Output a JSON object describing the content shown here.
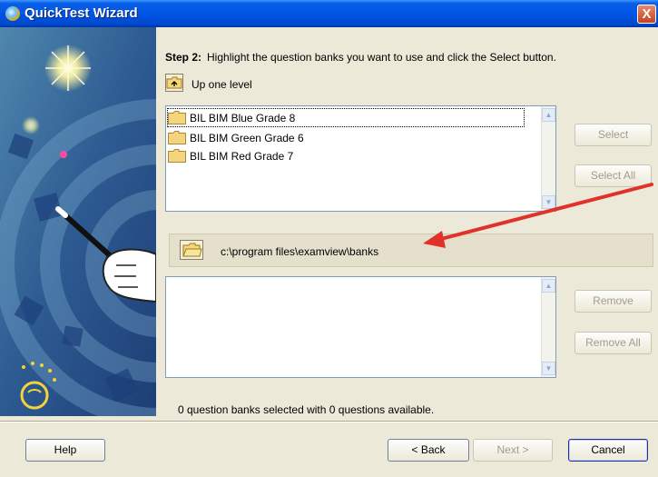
{
  "window": {
    "title": "QuickTest Wizard",
    "close_glyph": "X"
  },
  "step": {
    "number": "Step 2:",
    "instruction": "Highlight the question banks you want to use and click the Select button."
  },
  "up_one_level": {
    "label": "Up one level",
    "icon": "folder-up-icon"
  },
  "banks_list": {
    "items": [
      {
        "label": "BIL BIM Blue Grade 8",
        "icon": "folder-icon",
        "focused": true
      },
      {
        "label": "BIL BIM Green Grade 6",
        "icon": "folder-icon"
      },
      {
        "label": "BIL BIM Red Grade 7",
        "icon": "folder-icon"
      }
    ]
  },
  "buttons": {
    "select": "Select",
    "select_all": "Select All",
    "remove": "Remove",
    "remove_all": "Remove All",
    "help": "Help",
    "back": "< Back",
    "next": "Next >",
    "cancel": "Cancel"
  },
  "path": {
    "value": "c:\\program files\\examview\\banks"
  },
  "selected_list": {
    "items": []
  },
  "status": {
    "text": "0 question banks selected with 0 questions available."
  },
  "colors": {
    "titlebar": "#0055e5",
    "annotation_arrow": "#e0322b",
    "dialog_bg": "#ece9d8"
  }
}
